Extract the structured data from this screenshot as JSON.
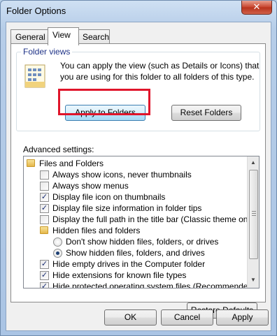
{
  "window": {
    "title": "Folder Options",
    "close_glyph": "✕"
  },
  "tabs": [
    {
      "label": "General",
      "active": false
    },
    {
      "label": "View",
      "active": true
    },
    {
      "label": "Search",
      "active": false
    }
  ],
  "folder_views": {
    "title": "Folder views",
    "description": "You can apply the view (such as Details or Icons) that you are using for this folder to all folders of this type.",
    "apply_button": "Apply to Folders",
    "reset_button": "Reset Folders",
    "icon": "folder-view-icon"
  },
  "advanced": {
    "label": "Advanced settings:",
    "items": [
      {
        "type": "folder",
        "indent": 0,
        "label": "Files and Folders"
      },
      {
        "type": "checkbox",
        "indent": 1,
        "checked": false,
        "label": "Always show icons, never thumbnails"
      },
      {
        "type": "checkbox",
        "indent": 1,
        "checked": false,
        "label": "Always show menus"
      },
      {
        "type": "checkbox",
        "indent": 1,
        "checked": true,
        "label": "Display file icon on thumbnails"
      },
      {
        "type": "checkbox",
        "indent": 1,
        "checked": true,
        "label": "Display file size information in folder tips"
      },
      {
        "type": "checkbox",
        "indent": 1,
        "checked": false,
        "label": "Display the full path in the title bar (Classic theme only)"
      },
      {
        "type": "folder",
        "indent": 1,
        "label": "Hidden files and folders"
      },
      {
        "type": "radio",
        "indent": 2,
        "checked": false,
        "label": "Don't show hidden files, folders, or drives"
      },
      {
        "type": "radio",
        "indent": 2,
        "checked": true,
        "label": "Show hidden files, folders, and drives"
      },
      {
        "type": "checkbox",
        "indent": 1,
        "checked": true,
        "label": "Hide empty drives in the Computer folder"
      },
      {
        "type": "checkbox",
        "indent": 1,
        "checked": true,
        "label": "Hide extensions for known file types"
      },
      {
        "type": "checkbox",
        "indent": 1,
        "checked": true,
        "label": "Hide protected operating system files (Recommended)"
      }
    ],
    "restore_button": "Restore Defaults"
  },
  "footer": {
    "ok": "OK",
    "cancel": "Cancel",
    "apply": "Apply"
  },
  "colors": {
    "highlight": "#e0152b"
  }
}
